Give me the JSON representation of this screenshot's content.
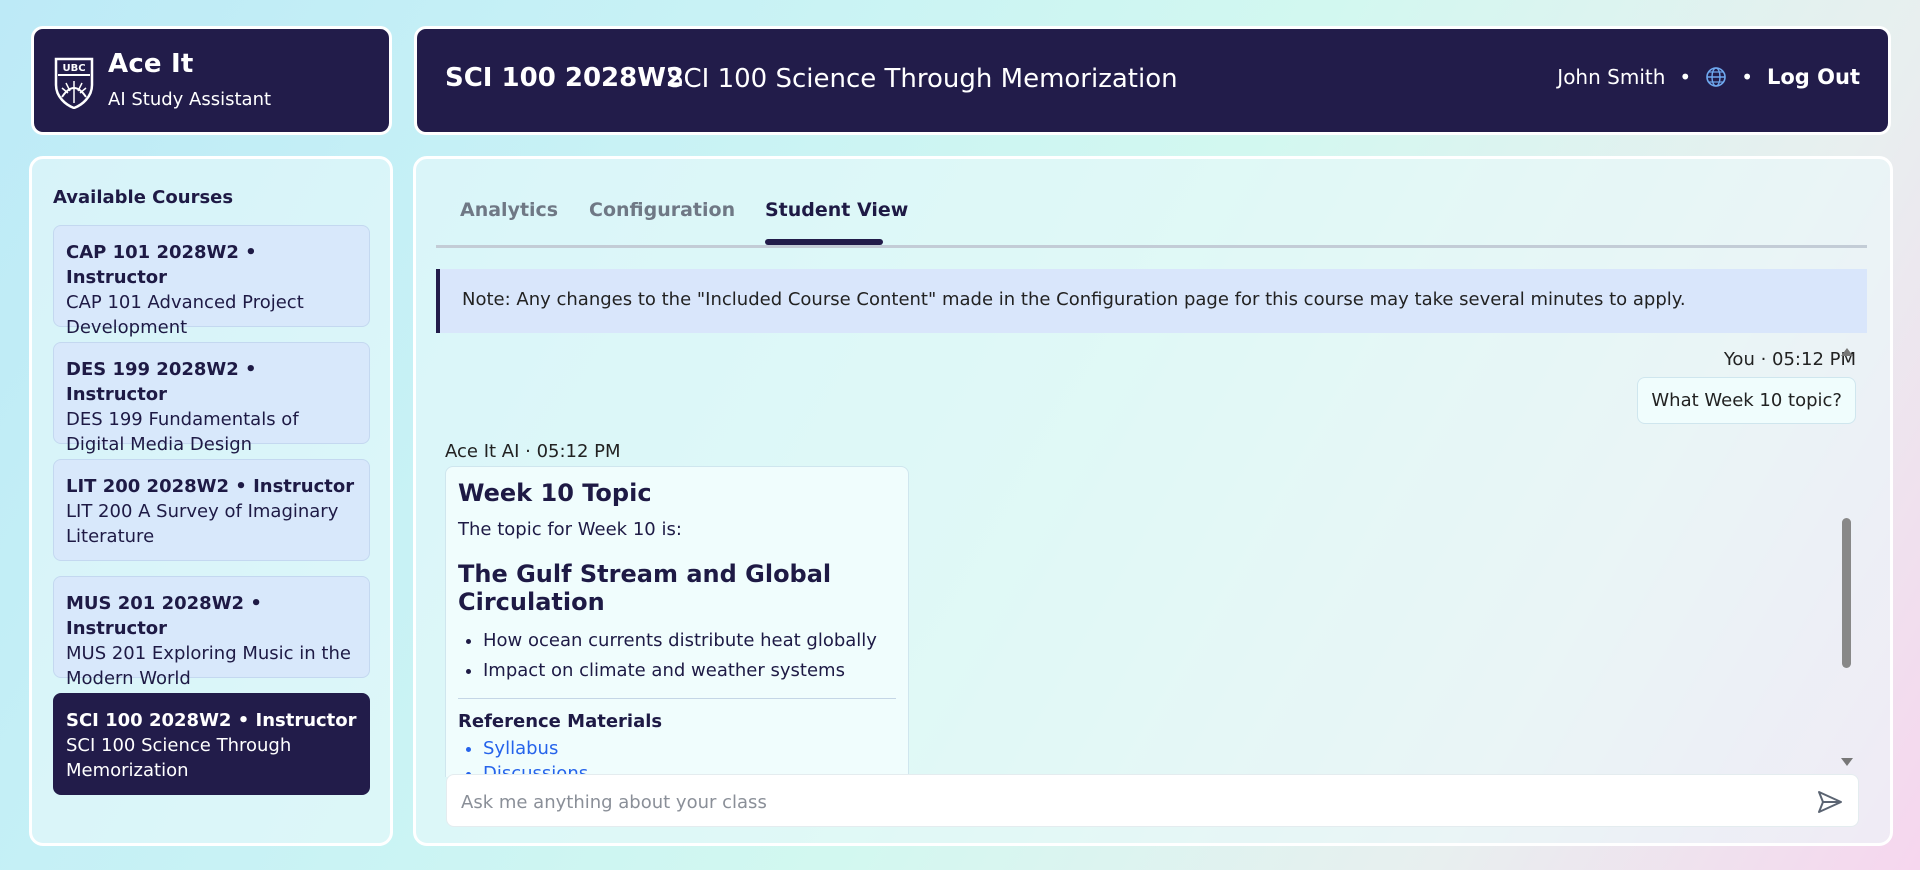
{
  "brand": {
    "logo_text": "UBC",
    "title": "Ace It",
    "subtitle": "AI Study Assistant"
  },
  "header": {
    "course_code": "SCI 100 2028W2",
    "course_name": "SCI 100 Science Through Memorization",
    "user_name": "John Smith",
    "separator": "•",
    "language_icon": "globe-icon",
    "logout_label": "Log Out"
  },
  "sidebar": {
    "title": "Available Courses",
    "courses": [
      {
        "code": "CAP 101 2028W2 • Instructor",
        "name": "CAP 101 Advanced Project Development"
      },
      {
        "code": "DES 199 2028W2 • Instructor",
        "name": "DES 199 Fundamentals of Digital Media Design"
      },
      {
        "code": "LIT 200 2028W2 • Instructor",
        "name": "LIT 200 A Survey of Imaginary Literature"
      },
      {
        "code": "MUS 201 2028W2 • Instructor",
        "name": "MUS 201 Exploring Music in the Modern World"
      },
      {
        "code": "SCI 100 2028W2 • Instructor",
        "name": "SCI 100 Science Through Memorization"
      }
    ]
  },
  "tabs": [
    {
      "label": "Analytics"
    },
    {
      "label": "Configuration"
    },
    {
      "label": "Student View"
    }
  ],
  "note": "Note: Any changes to the \"Included Course Content\" made in the Configuration page for this course may take several minutes to apply.",
  "chat": {
    "user_meta": "You · 05:12 PM",
    "user_message": "What Week 10 topic?",
    "ai_meta": "Ace It AI · 05:12 PM",
    "ai_title": "Week 10 Topic",
    "ai_intro": "The topic for Week 10 is:",
    "ai_topic": "The Gulf Stream and Global Circulation",
    "ai_points": [
      "How ocean currents distribute heat globally",
      "Impact on climate and weather systems"
    ],
    "ref_heading": "Reference Materials",
    "refs": [
      "Syllabus",
      "Discussions"
    ]
  },
  "input": {
    "placeholder": "Ask me anything about your class",
    "send_icon": "send-icon"
  },
  "colors": {
    "navy": "#221c4a",
    "card": "#d8e8fb",
    "link": "#2563eb"
  }
}
